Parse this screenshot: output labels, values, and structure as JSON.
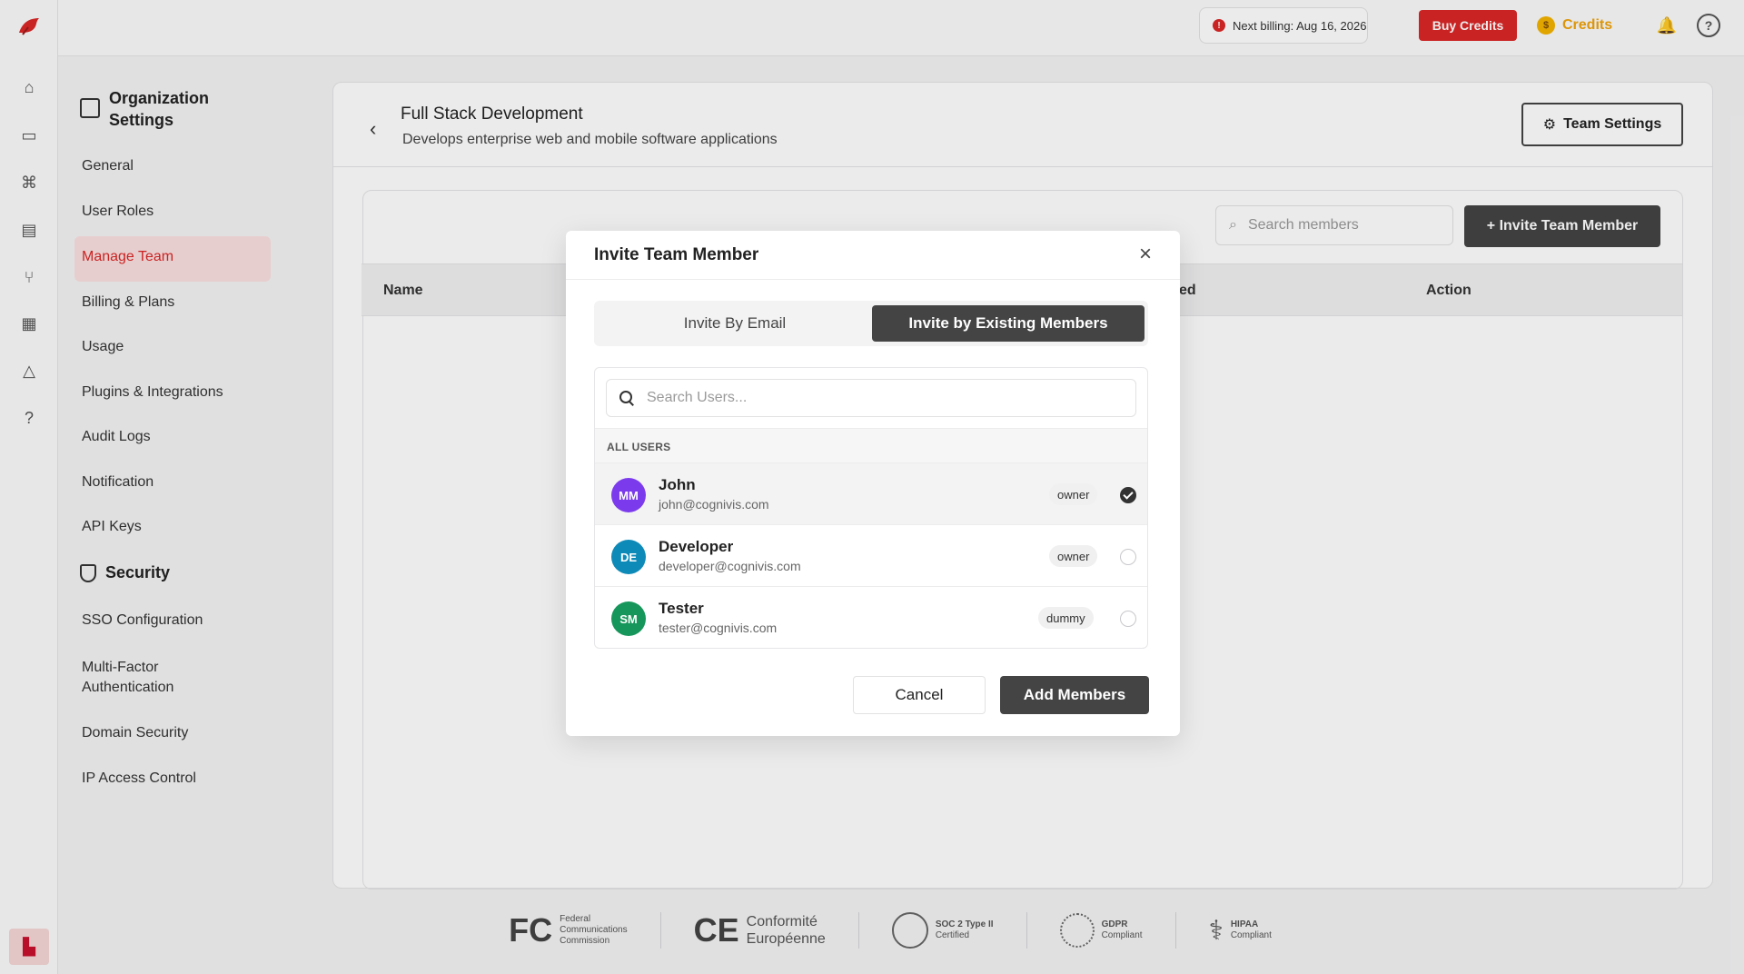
{
  "topbar": {
    "billing_text": "Next billing: Aug 16, 2026",
    "buy_credits": "Buy Credits",
    "credits_label": "Credits",
    "coin_symbol": "$"
  },
  "settings_nav": {
    "heading": "Organization Settings",
    "items": [
      "General",
      "User Roles",
      "Manage Team",
      "Billing & Plans",
      "Usage",
      "Plugins & Integrations",
      "Audit Logs",
      "Notification",
      "API Keys"
    ],
    "security_heading": "Security",
    "security_items": [
      "SSO Configuration",
      "Multi-Factor Authentication",
      "Domain Security",
      "IP Access Control"
    ]
  },
  "team": {
    "title": "Full Stack Development",
    "subtitle": "Develops enterprise web and mobile software applications",
    "settings_button": "Team Settings",
    "search_placeholder": "Search members",
    "invite_button": "+ Invite Team Member",
    "columns": [
      "Name",
      "ed",
      "Action"
    ]
  },
  "footer": {
    "fcc_lines": [
      "Federal",
      "Communications",
      "Commission"
    ],
    "ce_lines": [
      "Conformité",
      "Européenne"
    ],
    "soc2": "SOC 2 Type II",
    "soc2_sub": "Certified",
    "gdpr": "GDPR",
    "gdpr_sub": "Compliant",
    "hipaa": "HIPAA",
    "hipaa_sub": "Compliant"
  },
  "modal": {
    "title": "Invite Team Member",
    "tab_email": "Invite By Email",
    "tab_existing": "Invite by Existing Members",
    "search_placeholder": "Search Users...",
    "section_label": "ALL USERS",
    "users": [
      {
        "initials": "MM",
        "name": "John",
        "email": "john@cognivis.com",
        "role": "owner",
        "checked": true,
        "color": "#7c3aed"
      },
      {
        "initials": "DE",
        "name": "Developer",
        "email": "developer@cognivis.com",
        "role": "owner",
        "checked": false,
        "color": "#0e8ab8"
      },
      {
        "initials": "SM",
        "name": "Tester",
        "email": "tester@cognivis.com",
        "role": "dummy",
        "checked": false,
        "color": "#16965a"
      }
    ],
    "cancel": "Cancel",
    "add": "Add Members"
  }
}
